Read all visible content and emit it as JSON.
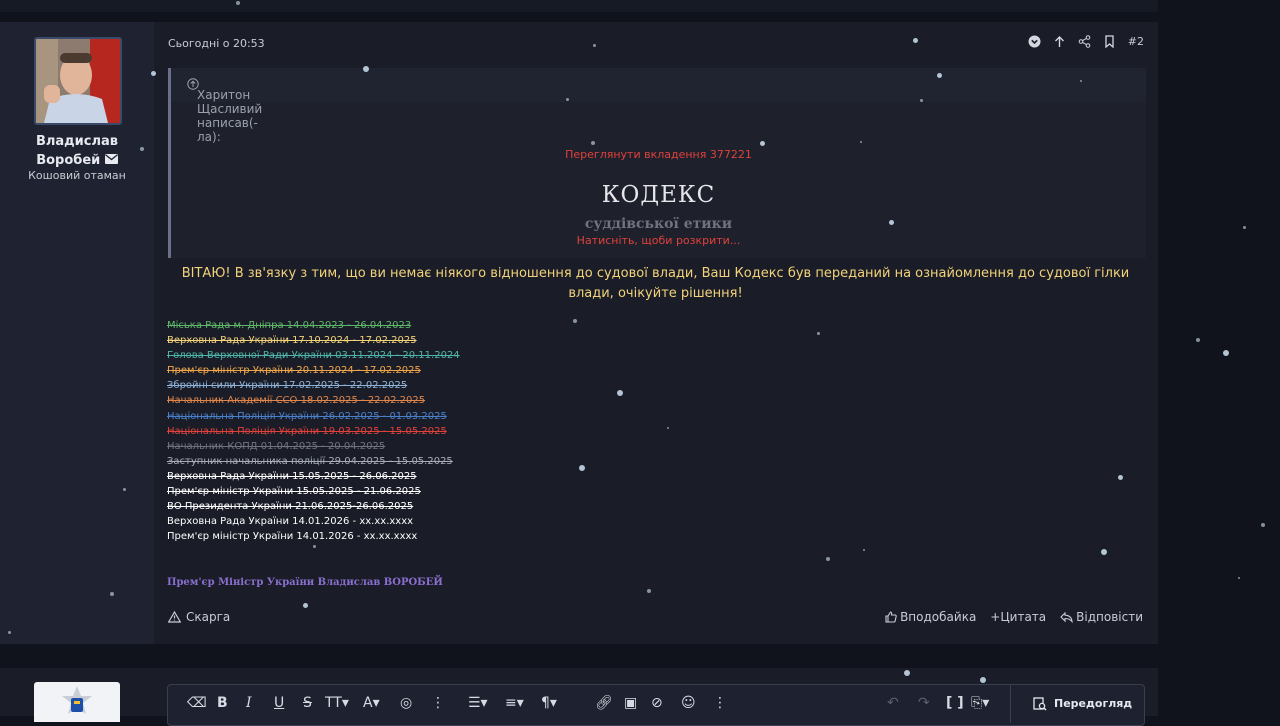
{
  "post": {
    "time": "Сьогодні о 20:53",
    "number": "#2",
    "user": {
      "name_line1": "Владислав",
      "name_line2": "Воробей",
      "title": "Кошовий отаман"
    },
    "quote": {
      "author": "Харитон Щасливий написав(-ла):",
      "attachment_link": "Переглянути вкладення 377221",
      "image_title": "КОДЕКС",
      "image_subtitle": "суддівської етики",
      "expand": "Натисніть, щоби розкрити..."
    },
    "greeting": "ВІТАЮ! В зв'язку з тим, що ви немає ніякого відношення до судової влади, Ваш Кодекс був переданий на ознайомлення до судової гілки влади, очікуйте рішення!",
    "history": [
      {
        "text": "Міська Рада м. Дніпра 14.04.2023 - 26.04.2023",
        "color": "#5fb86a",
        "struck": true
      },
      {
        "text": "Верховна Рада України 17.10.2024 - 17.02.2025",
        "color": "#f2d27a",
        "struck": true
      },
      {
        "text": "Голова Верховної Ради України 03.11.2024 - 20.11.2024",
        "color": "#4fb5a8",
        "struck": true
      },
      {
        "text": "Прем'єр міністр України 20.11.2024 - 17.02.2025",
        "color": "#f0a64a",
        "struck": true
      },
      {
        "text": "Збройні сили України 17.02.2025 - 22.02.2025",
        "color": "#8fb3d9",
        "struck": true
      },
      {
        "text": "Начальник Академії ССО 18.02.2025 - 22.02.2025",
        "color": "#e0864a",
        "struck": true
      },
      {
        "text": "Національна Поліція України 26.02.2025 - 01.03.2025",
        "color": "#4a80c9",
        "struck": true
      },
      {
        "text": "Національна Поліція України 19.03.2025 - 15.05.2025",
        "color": "#e0413b",
        "struck": true
      },
      {
        "text": "Начальник КОПД 01.04.2025 - 20.04.2025",
        "color": "#6f7380",
        "struck": true
      },
      {
        "text": "Заступник начальника поліції 29.04.2025 - 15.05.2025",
        "color": "#a8acb6",
        "struck": true
      },
      {
        "text": "Верховна Рада України 15.05.2025 - 26.06.2025",
        "color": "#ffffff",
        "struck": true
      },
      {
        "text": "Прем'єр міністр України 15.05.2025 - 21.06.2025",
        "color": "#ffffff",
        "struck": true
      },
      {
        "text": "ВО Президента України 21.06.2025-26.06.2025",
        "color": "#ffffff",
        "struck": true
      },
      {
        "text": "Верховна Рада України 14.01.2026 - хх.хх.хххх",
        "color": "#ffffff",
        "struck": false
      },
      {
        "text": "Прем'єр міністр України 14.01.2026 - хх.хх.хххх",
        "color": "#ffffff",
        "struck": false
      }
    ],
    "signature": "Прем'єр Міністр України Владислав ВОРОБЕЙ",
    "report_label": "Скарга",
    "like_label": "Вподобайка",
    "quote_label": "+Цитата",
    "reply_label": "Відповісти"
  },
  "editor": {
    "preview_label": "Передогляд"
  },
  "colors": {
    "accent_red": "#e0413b",
    "greeting": "#f2d27a",
    "signature": "#8a6fcf"
  }
}
